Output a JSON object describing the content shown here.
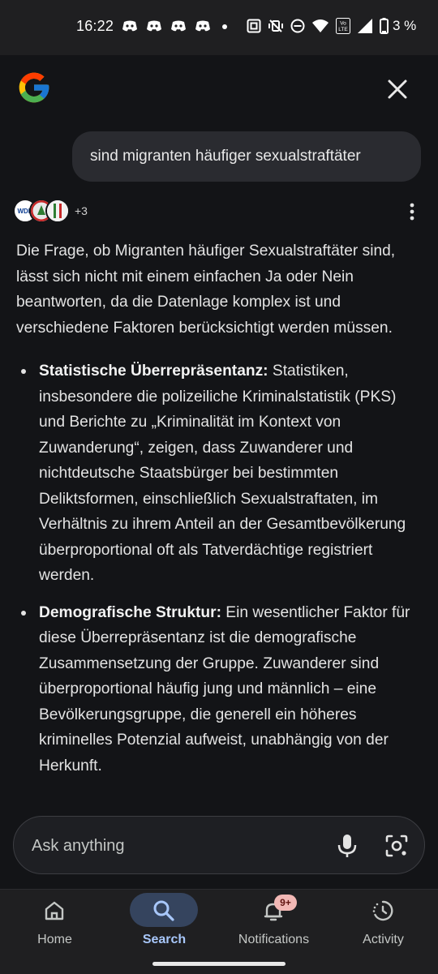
{
  "status_bar": {
    "time": "16:22",
    "battery": "3 %",
    "icons": [
      "discord-icon",
      "discord-icon",
      "discord-icon",
      "discord-icon",
      "dot-icon",
      "nfc-icon",
      "vibrate-off-icon",
      "dnd-icon",
      "wifi-icon",
      "volte-icon",
      "signal-icon",
      "battery-icon"
    ],
    "volte_label": "Vo\nLTE"
  },
  "header": {
    "logo": "google-logo-icon",
    "close": "close-icon"
  },
  "query": {
    "text": "sind migranten häufiger sexualstraftäter"
  },
  "sources": {
    "wdr_label": "WDR",
    "more_count": "+3"
  },
  "answer": {
    "intro": "Die Frage, ob Migranten häufiger Sexualstraftäter sind, lässt sich nicht mit einem einfachen Ja oder Nein beantworten, da die Datenlage komplex ist und verschiedene Faktoren berücksichtigt werden müssen.",
    "bullets": [
      {
        "title": "Statistische Überrepräsentanz:",
        "text": " Statistiken, insbesondere die polizeiliche Kriminalstatistik (PKS) und Berichte zu „Kriminalität im Kontext von Zuwanderung“, zeigen, dass Zuwanderer und nichtdeutsche Staatsbürger bei bestimmten Deliktsformen, einschließlich Sexualstraftaten, im Verhältnis zu ihrem Anteil an der Gesamtbevölkerung überproportional oft als Tatverdächtige registriert werden."
      },
      {
        "title": "Demografische Struktur:",
        "text": " Ein wesentlicher Faktor für diese Überrepräsentanz ist die demografische Zusammensetzung der Gruppe. Zuwanderer sind überproportional häufig jung und männlich – eine Bevölkerungsgruppe, die generell ein höheres kriminelles Potenzial aufweist, unabhängig von der Herkunft."
      }
    ]
  },
  "ask": {
    "placeholder": "Ask anything"
  },
  "nav": {
    "items": [
      {
        "label": "Home",
        "icon": "home-icon"
      },
      {
        "label": "Search",
        "icon": "search-icon",
        "active": true
      },
      {
        "label": "Notifications",
        "icon": "bell-icon",
        "badge": "9+"
      },
      {
        "label": "Activity",
        "icon": "activity-icon"
      }
    ]
  },
  "colors": {
    "accent": "#a8c7fa",
    "active_pill": "#35445e",
    "badge": "#f2b8b5"
  }
}
